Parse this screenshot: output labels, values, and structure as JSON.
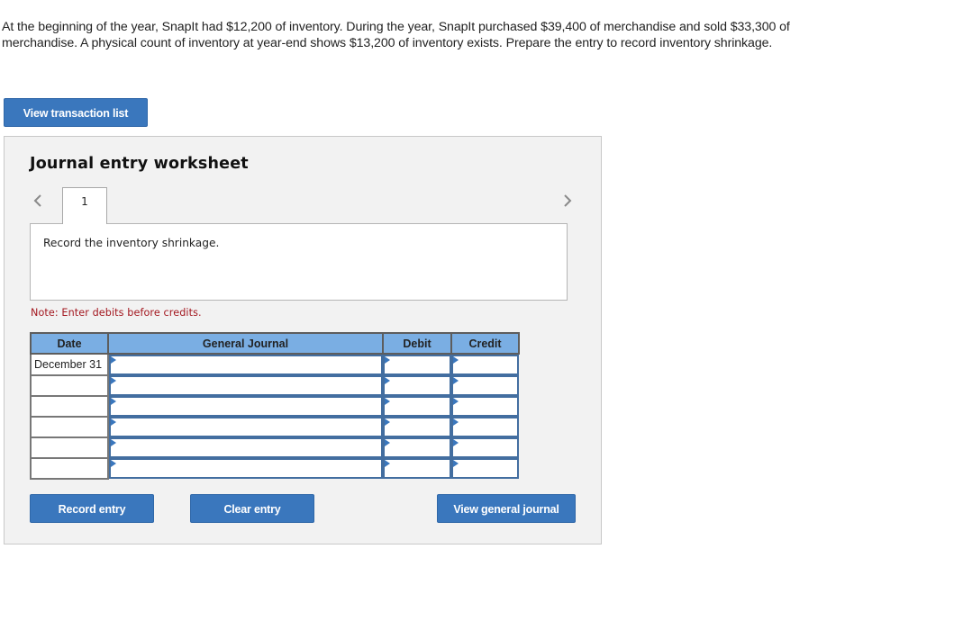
{
  "question": {
    "text": "At the beginning of the year, SnapIt had $12,200 of inventory. During the year, SnapIt purchased $39,400 of merchandise and sold $33,300 of merchandise. A physical count of inventory at year-end shows $13,200 of inventory exists. Prepare the entry to record inventory shrinkage."
  },
  "buttons": {
    "view_transaction_list": "View transaction list",
    "record_entry": "Record entry",
    "clear_entry": "Clear entry",
    "view_general_journal": "View general journal"
  },
  "worksheet": {
    "title": "Journal entry worksheet",
    "nav": {
      "prev_icon": "chevron-left-icon",
      "next_icon": "chevron-right-icon"
    },
    "tabs": [
      {
        "label": "1",
        "active": true
      }
    ],
    "instruction": "Record the inventory shrinkage.",
    "note": "Note: Enter debits before credits."
  },
  "journal_table": {
    "headers": {
      "date": "Date",
      "general_journal": "General Journal",
      "debit": "Debit",
      "credit": "Credit"
    },
    "rows": [
      {
        "date": "December 31",
        "account": "",
        "debit": "",
        "credit": ""
      },
      {
        "date": "",
        "account": "",
        "debit": "",
        "credit": ""
      },
      {
        "date": "",
        "account": "",
        "debit": "",
        "credit": ""
      },
      {
        "date": "",
        "account": "",
        "debit": "",
        "credit": ""
      },
      {
        "date": "",
        "account": "",
        "debit": "",
        "credit": ""
      },
      {
        "date": "",
        "account": "",
        "debit": "",
        "credit": ""
      }
    ]
  },
  "colors": {
    "button_blue": "#3a77bd",
    "header_blue": "#7aaee3",
    "note_red": "#a3171f",
    "panel_gray": "#f2f2f2"
  }
}
